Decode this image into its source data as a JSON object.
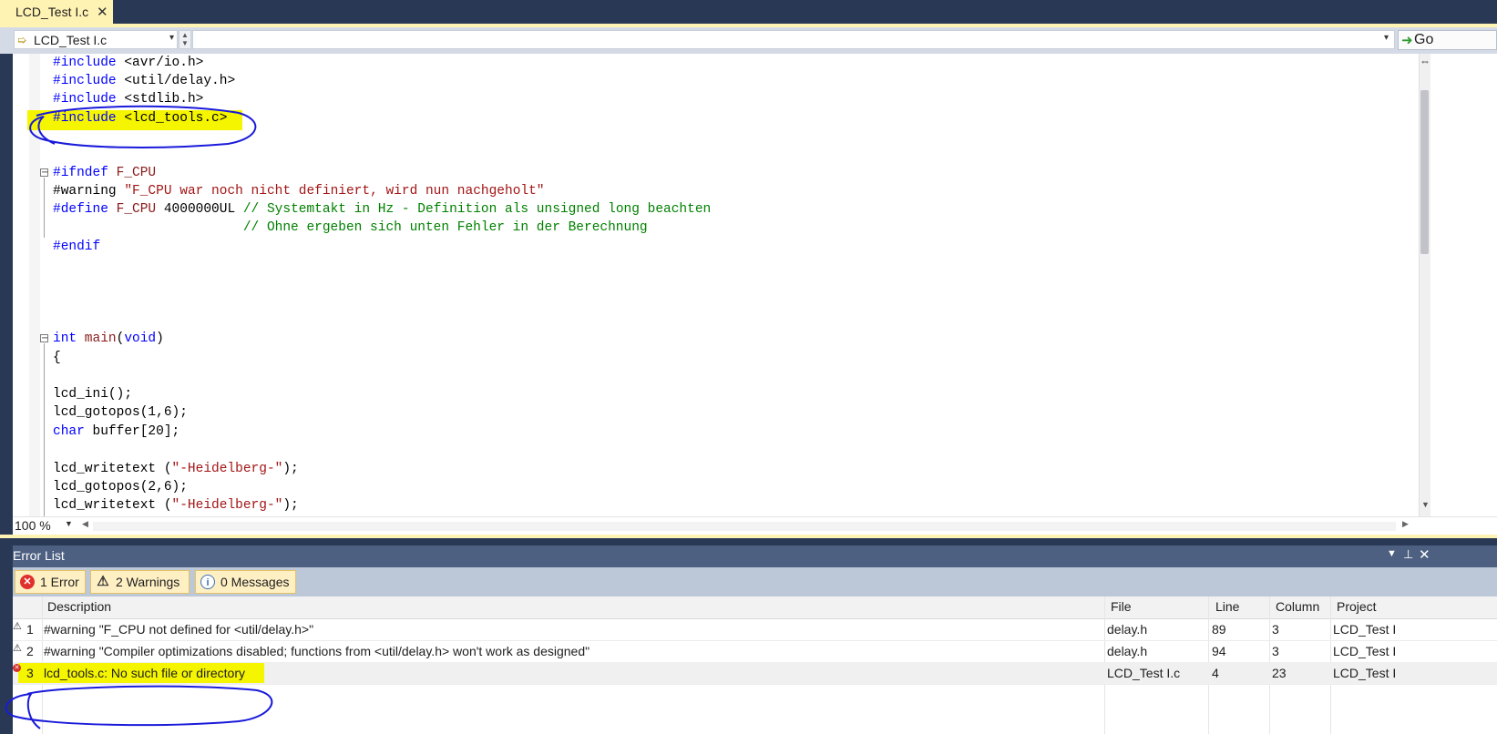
{
  "tab": {
    "label": "LCD_Test I.c",
    "close_glyph": "✕"
  },
  "navbar": {
    "file_label": "LCD_Test I.c",
    "go_label": "Go",
    "file_icon": "arrow-right-icon",
    "go_icon": "go-arrow-icon"
  },
  "editor": {
    "lines": {
      "l1": {
        "kw": "#include",
        "rest": " <avr/io.h>"
      },
      "l2": {
        "kw": "#include",
        "rest": " <util/delay.h>"
      },
      "l3": {
        "kw": "#include",
        "rest": " <stdlib.h>"
      },
      "l4": {
        "kw": "#include",
        "rest": " <lcd_tools.c>"
      },
      "l5": {
        "kw": "#ifndef",
        "mac": " F_CPU"
      },
      "l6": {
        "kw": "#warning",
        "str": " \"F_CPU war noch nicht definiert, wird nun nachgeholt\""
      },
      "l7": {
        "kw": "#define",
        "mac": " F_CPU",
        "plain": " 4000000UL",
        "cmt": " // Systemtakt in Hz - Definition als unsigned long beachten"
      },
      "l8": {
        "cmt": "                        // Ohne ergeben sich unten Fehler in der Berechnung"
      },
      "l9": {
        "kw": "#endif"
      },
      "l10": {
        "kw": "int",
        "fn": " main",
        "p1": "(",
        "kw2": "void",
        "p2": ")"
      },
      "l11": {
        "plain": "{"
      },
      "l12": {
        "plain": "lcd_ini();"
      },
      "l13": {
        "plain": "lcd_gotopos(1,6);"
      },
      "l14": {
        "kw": "char",
        "plain": " buffer[20];"
      },
      "l15": {
        "plain": "lcd_writetext (",
        "str": "\"-Heidelberg-\"",
        "plain2": ");"
      },
      "l16": {
        "plain": "lcd_gotopos(2,6);"
      },
      "l17": {
        "plain": "lcd_writetext (",
        "str": "\"-Heidelberg-\"",
        "plain2": ");"
      }
    },
    "zoom": "100 %",
    "highlight_color": "#f5f500",
    "annotation_color": "#1a1adb"
  },
  "error_list": {
    "title": "Error List",
    "filters": {
      "errors": "1 Error",
      "warnings": "2 Warnings",
      "messages": "0 Messages"
    },
    "columns": {
      "description": "Description",
      "file": "File",
      "line": "Line",
      "column": "Column",
      "project": "Project"
    },
    "rows": [
      {
        "num": "1",
        "type": "warning",
        "description": "#warning \"F_CPU not defined for <util/delay.h>\"",
        "file": "delay.h",
        "line": "89",
        "column": "3",
        "project": "LCD_Test I"
      },
      {
        "num": "2",
        "type": "warning",
        "description": "#warning \"Compiler optimizations disabled; functions from <util/delay.h> won't work as designed\"",
        "file": "delay.h",
        "line": "94",
        "column": "3",
        "project": "LCD_Test I"
      },
      {
        "num": "3",
        "type": "error",
        "description": "lcd_tools.c: No such file or directory",
        "file": "LCD_Test I.c",
        "line": "4",
        "column": "23",
        "project": "LCD_Test I"
      }
    ]
  }
}
